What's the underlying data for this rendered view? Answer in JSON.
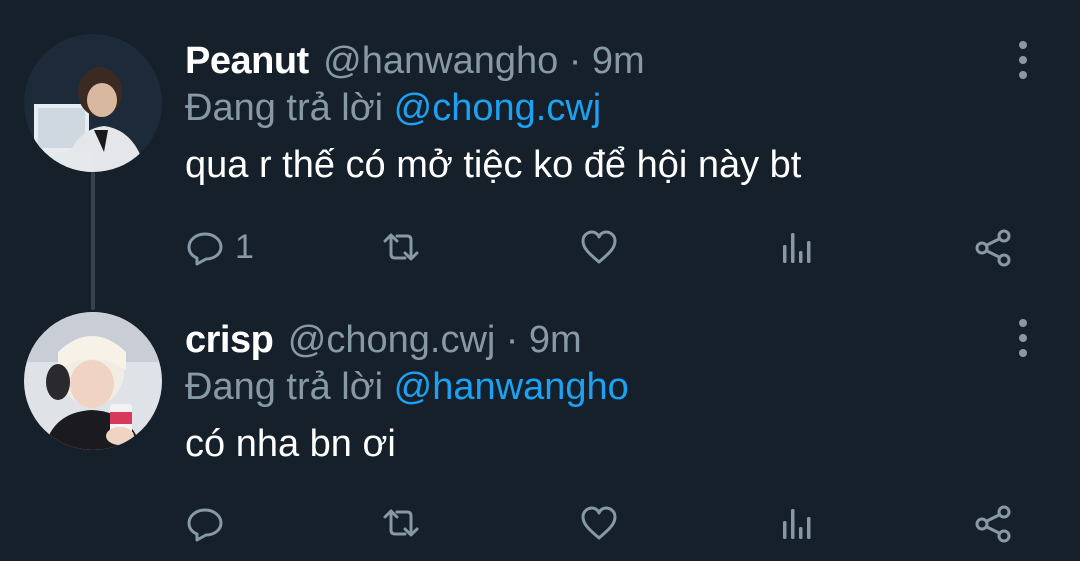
{
  "tweets": [
    {
      "display_name": "Peanut",
      "handle": "@hanwangho",
      "separator": "·",
      "time": "9m",
      "reply_prefix": "Đang trả lời",
      "reply_to": "@chong.cwj",
      "text": "qua r thế có mở tiệc ko để hội này bt",
      "reply_count": "1"
    },
    {
      "display_name": "crisp",
      "handle": "@chong.cwj",
      "separator": "·",
      "time": "9m",
      "reply_prefix": "Đang trả lời",
      "reply_to": "@hanwangho",
      "text": "có nha bn ơi",
      "reply_count": ""
    }
  ],
  "icons": {
    "reply": "reply-icon",
    "retweet": "retweet-icon",
    "like": "heart-icon",
    "analytics": "analytics-icon",
    "share": "share-icon",
    "more": "more-vertical-icon"
  },
  "colors": {
    "background": "#15202b",
    "secondary_text": "#8899a6",
    "mention": "#1da1f2",
    "thread_line": "#38444d"
  }
}
